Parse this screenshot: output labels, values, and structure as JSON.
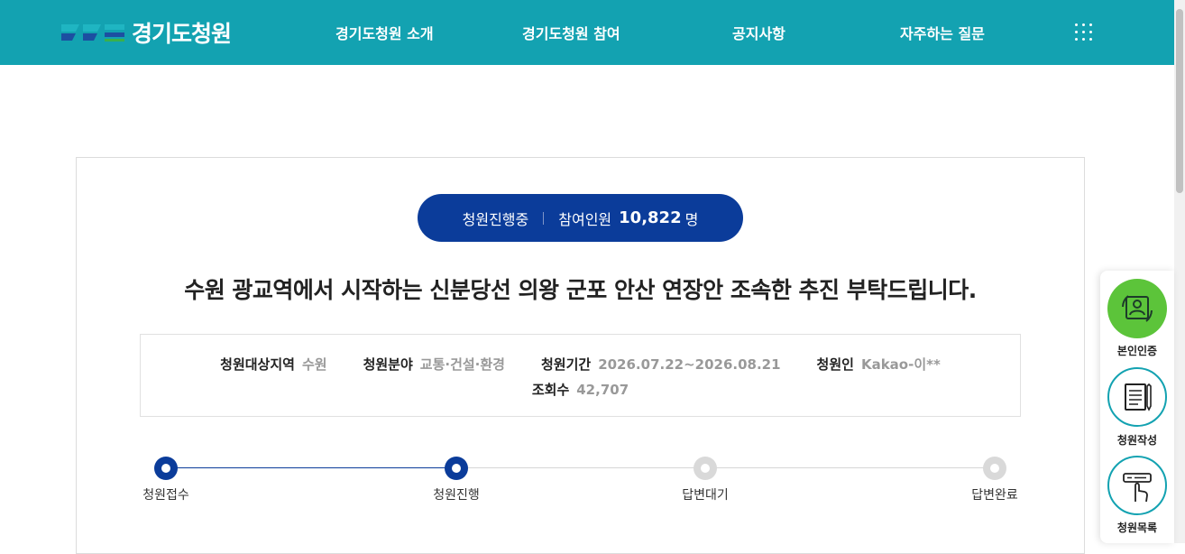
{
  "header": {
    "logo_text": "경기도청원",
    "nav": [
      "경기도청원 소개",
      "경기도청원 참여",
      "공지사항",
      "자주하는 질문"
    ]
  },
  "petition": {
    "status": "청원진행중",
    "participants_label": "참여인원",
    "participants_count": "10,822",
    "participants_unit": "명",
    "title": "수원 광교역에서 시작하는 신분당선 의왕 군포 안산 연장안 조속한 추진 부탁드립니다.",
    "info": {
      "region_label": "청원대상지역",
      "region_value": "수원",
      "field_label": "청원분야",
      "field_value": "교통·건설·환경",
      "period_label": "청원기간",
      "period_value": "2026.07.22~2026.08.21",
      "petitioner_label": "청원인",
      "petitioner_value": "Kakao-이**",
      "views_label": "조회수",
      "views_value": "42,707"
    },
    "steps": [
      {
        "label": "청원접수",
        "done": true
      },
      {
        "label": "청원진행",
        "done": true
      },
      {
        "label": "답변대기",
        "done": false
      },
      {
        "label": "답변완료",
        "done": false
      }
    ]
  },
  "quick_menu": [
    {
      "label": "본인인증",
      "icon": "id-verify-icon"
    },
    {
      "label": "청원작성",
      "icon": "write-document-icon"
    },
    {
      "label": "청원목록",
      "icon": "list-touch-icon"
    }
  ],
  "colors": {
    "header_bg": "#13a2b1",
    "accent_navy": "#0b3c9a",
    "quick_green": "#5cc43a"
  }
}
